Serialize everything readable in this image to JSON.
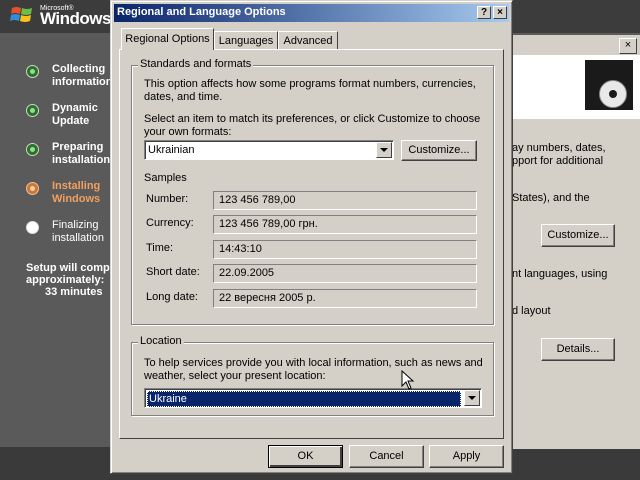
{
  "setup": {
    "logo_small": "Microsoft®",
    "logo_text": "Windows",
    "steps": [
      {
        "label1": "Collecting",
        "label2": "information",
        "state": "done"
      },
      {
        "label1": "Dynamic",
        "label2": "Update",
        "state": "done"
      },
      {
        "label1": "Preparing",
        "label2": "installation",
        "state": "done"
      },
      {
        "label1": "Installing",
        "label2": "Windows",
        "state": "active"
      },
      {
        "label1": "Finalizing",
        "label2": "installation",
        "state": "pending"
      }
    ],
    "complete_line1": "Setup will comp",
    "complete_line2": "approximately:",
    "complete_line3": "33 minutes"
  },
  "back_window": {
    "close": "×",
    "text1": "ay numbers, dates,",
    "text2": "pport for additional",
    "text3": "States), and the",
    "customize": "Customize...",
    "text4": "nt languages, using",
    "text5": "d layout",
    "details": "Details..."
  },
  "dialog": {
    "title": "Regional and Language Options",
    "help_btn": "?",
    "close_btn": "×",
    "tabs": [
      "Regional Options",
      "Languages",
      "Advanced"
    ],
    "standards": {
      "legend": "Standards and formats",
      "desc1": "This option affects how some programs format numbers, currencies,",
      "desc2": "dates, and time.",
      "select1": "Select an item to match its preferences, or click Customize to choose",
      "select2": "your own formats:",
      "format_value": "Ukrainian",
      "customize": "Customize...",
      "samples_label": "Samples",
      "samples": [
        {
          "label": "Number:",
          "value": "123 456 789,00"
        },
        {
          "label": "Currency:",
          "value": "123 456 789,00 грн."
        },
        {
          "label": "Time:",
          "value": "14:43:10"
        },
        {
          "label": "Short date:",
          "value": "22.09.2005"
        },
        {
          "label": "Long date:",
          "value": "22 вересня 2005 р."
        }
      ]
    },
    "location": {
      "legend": "Location",
      "desc1": "To help services provide you with local information, such as news and",
      "desc2": "weather, select your present location:",
      "value": "Ukraine"
    },
    "buttons": {
      "ok": "OK",
      "cancel": "Cancel",
      "apply": "Apply"
    }
  }
}
